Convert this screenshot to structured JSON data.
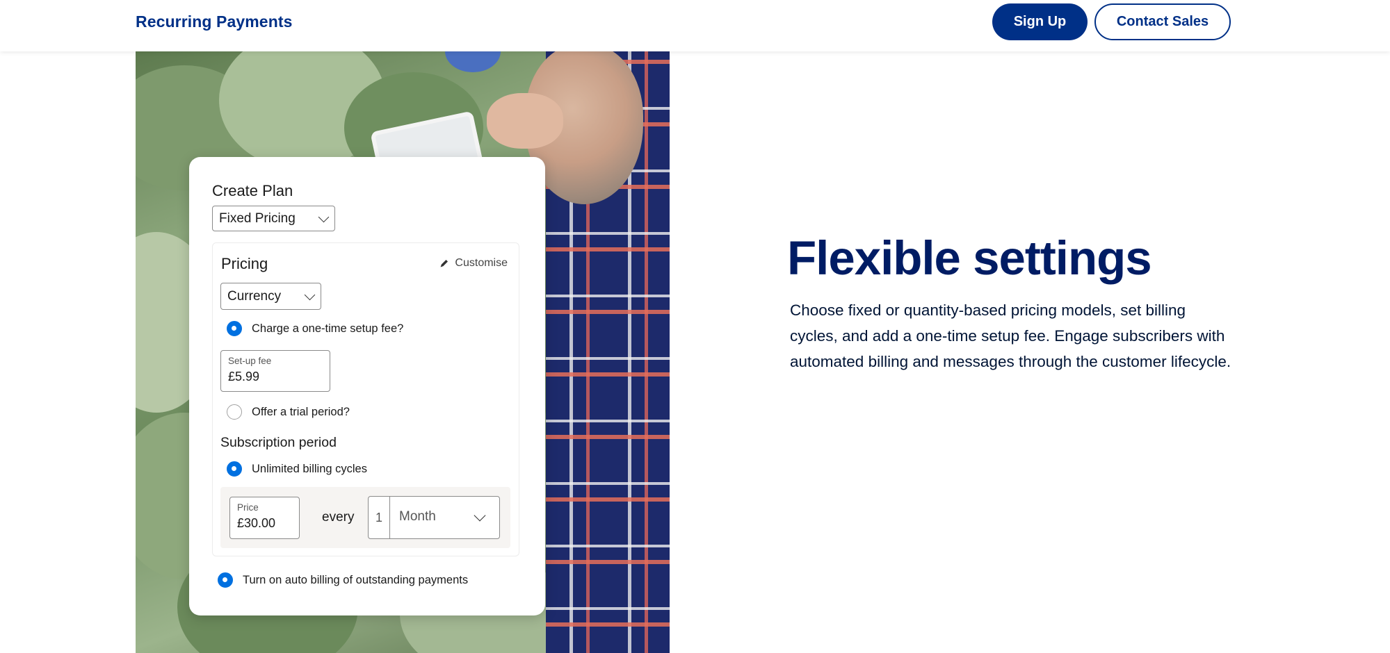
{
  "header": {
    "brand": "Recurring Payments",
    "sign_up": "Sign Up",
    "contact_sales": "Contact Sales"
  },
  "card": {
    "title": "Create Plan",
    "plan_type": "Fixed Pricing",
    "pricing": {
      "title": "Pricing",
      "customise": "Customise",
      "currency": "Currency",
      "setup_fee_question": "Charge a one-time setup fee?",
      "setup_fee_checked": true,
      "setup_fee_label": "Set-up fee",
      "setup_fee_value": "£5.99",
      "trial_question": "Offer a trial period?",
      "trial_checked": false,
      "subscription_title": "Subscription period",
      "unlimited_label": "Unlimited billing cycles",
      "unlimited_checked": true,
      "price_label": "Price",
      "price_value": "£30.00",
      "every": "every",
      "interval_count": "1",
      "interval_unit": "Month"
    },
    "auto_billing_label": "Turn on auto billing of outstanding payments",
    "auto_billing_checked": true
  },
  "hero": {
    "headline": "Flexible settings",
    "description": "Choose fixed or quantity-based pricing models, set billing cycles, and add a one-time setup fee. Engage subscribers with automated billing and messages through the customer lifecycle."
  },
  "colors": {
    "brand_navy": "#003087",
    "headline_navy": "#001c64",
    "radio_blue": "#0070e0"
  }
}
